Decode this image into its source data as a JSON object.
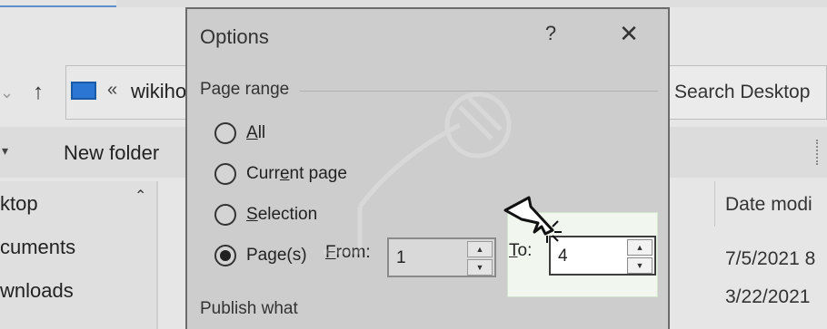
{
  "explorer": {
    "address": {
      "separator": "«",
      "path_text": "wikiho"
    },
    "search": {
      "placeholder": "Search Desktop"
    },
    "toolbar": {
      "new_folder_label": "New folder"
    },
    "nav_items": [
      "ktop",
      "cuments",
      "wnloads"
    ],
    "columns": {
      "date_header": "Date modi"
    },
    "rows": [
      {
        "date": "7/5/2021 8"
      },
      {
        "date": "3/22/2021"
      }
    ]
  },
  "dialog": {
    "title": "Options",
    "help_label": "?",
    "close_label": "✕",
    "page_range": {
      "title": "Page range",
      "options": [
        {
          "key": "A",
          "rest": "ll",
          "checked": false
        },
        {
          "key": "",
          "pre": "Curr",
          "key2": "e",
          "rest": "nt page",
          "checked": false
        },
        {
          "key": "S",
          "rest": "election",
          "checked": false
        },
        {
          "key": "",
          "pre": "Pa",
          "key2": "g",
          "rest": "e(s)",
          "checked": true
        }
      ],
      "from_label_key": "F",
      "from_label_rest": "rom:",
      "from_value": "1",
      "to_label_key": "T",
      "to_label_rest": "o:",
      "to_value": "4"
    },
    "publish_title": "Publish what"
  },
  "icons": {
    "up": "up-arrow-icon",
    "folder": "folder-icon",
    "cursor": "pointer-cursor-icon",
    "watermark": "one-click-activate-watermark"
  },
  "colors": {
    "dialog_bg": "#cdcdcd",
    "highlight_bg": "#f1f7ee",
    "folder_blue": "#2b76d2"
  }
}
